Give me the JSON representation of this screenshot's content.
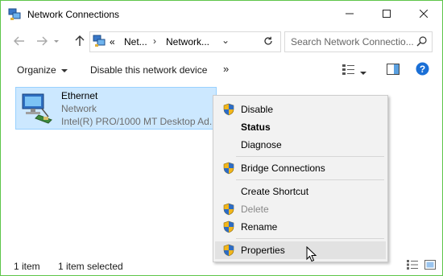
{
  "window": {
    "title": "Network Connections"
  },
  "address": {
    "crumb_prefix": "«",
    "crumbs": [
      "Net...",
      "Network..."
    ]
  },
  "search": {
    "placeholder": "Search Network Connectio..."
  },
  "toolbar": {
    "organize": "Organize",
    "disable_device": "Disable this network device",
    "more": "»"
  },
  "item": {
    "name": "Ethernet",
    "status": "Network",
    "adapter": "Intel(R) PRO/1000 MT Desktop Ad..."
  },
  "status": {
    "count": "1 item",
    "selected": "1 item selected"
  },
  "menu": {
    "items": [
      {
        "label": "Disable",
        "shield": true
      },
      {
        "label": "Status",
        "bold": true
      },
      {
        "label": "Diagnose"
      },
      {
        "label": "Bridge Connections",
        "shield": true
      },
      {
        "label": "Create Shortcut"
      },
      {
        "label": "Delete",
        "shield": true,
        "disabled": true
      },
      {
        "label": "Rename",
        "shield": true
      },
      {
        "label": "Properties",
        "shield": true,
        "hover": true
      }
    ]
  },
  "colors": {
    "selection": "#cce8ff",
    "selection_border": "#99d1ff",
    "window_border": "#5ec64a",
    "help": "#1a6fd6"
  }
}
